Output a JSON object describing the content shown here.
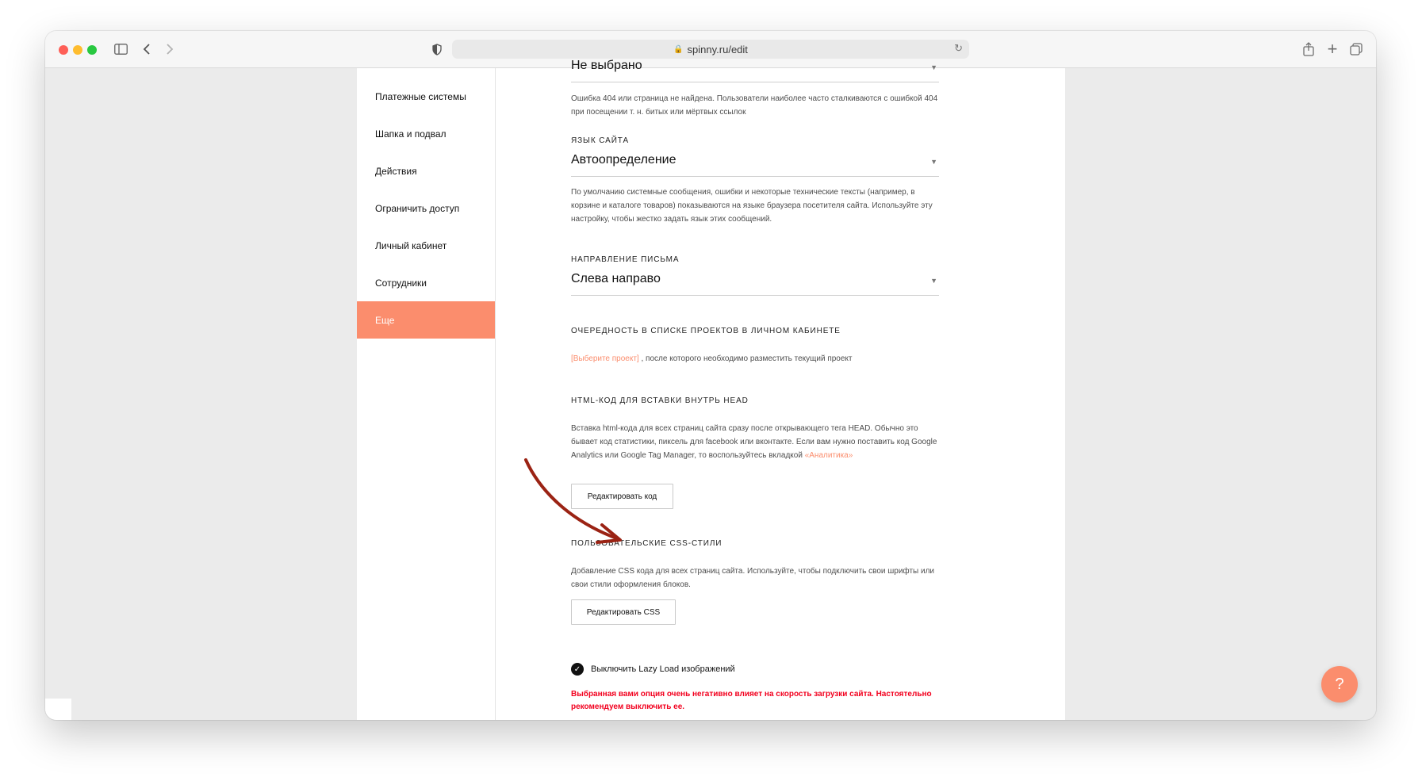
{
  "browser": {
    "url": "spinny.ru/edit"
  },
  "sidebar": {
    "items": [
      {
        "label": "Платежные системы"
      },
      {
        "label": "Шапка и подвал"
      },
      {
        "label": "Действия"
      },
      {
        "label": "Ограничить доступ"
      },
      {
        "label": "Личный кабинет"
      },
      {
        "label": "Сотрудники"
      },
      {
        "label": "Еще",
        "active": true
      }
    ]
  },
  "settings": {
    "page404": {
      "value": "Не выбрано",
      "hint": "Ошибка 404 или страница не найдена. Пользователи наиболее часто сталкиваются с ошибкой 404 при посещении т. н. битых или мёртвых ссылок"
    },
    "language": {
      "label": "Язык сайта",
      "value": "Автоопределение",
      "hint": "По умолчанию системные сообщения, ошибки и некоторые технические тексты (например, в корзине и каталоге товаров) показываются на языке браузера посетителя сайта. Используйте эту настройку, чтобы жестко задать язык этих сообщений."
    },
    "direction": {
      "label": "Направление письма",
      "value": "Слева направо"
    },
    "order": {
      "label": "Очередность в списке проектов в личном кабинете",
      "link": "[Выберите проект]",
      "text": " , после которого необходимо разместить текущий проект"
    },
    "head_html": {
      "label": "HTML-код для вставки внутрь HEAD",
      "hint_part1": "Вставка html-кода для всех страниц сайта сразу после открывающего тега HEAD. Обычно это бывает код статистики, пиксель для facebook или вконтакте. Если вам нужно поставить код Google Analytics или Google Tag Manager, то воспользуйтесь вкладкой ",
      "hint_link": "«Аналитика»",
      "button": "Редактировать код"
    },
    "css": {
      "label": "Пользовательские CSS-стили",
      "hint": "Добавление CSS кода для всех страниц сайта. Используйте, чтобы подключить свои шрифты или свои стили оформления блоков.",
      "button": "Редактировать CSS"
    },
    "lazy_load": {
      "label": "Выключить Lazy Load изображений",
      "checked": true,
      "warning": "Выбранная вами опция очень негативно влияет на скорость загрузки сайта. Настоятельно рекомендуем выключить ее."
    }
  },
  "help": {
    "symbol": "?"
  },
  "colors": {
    "accent": "#fb8d6d",
    "warning": "#f2001e",
    "arrow": "#9b2314"
  }
}
